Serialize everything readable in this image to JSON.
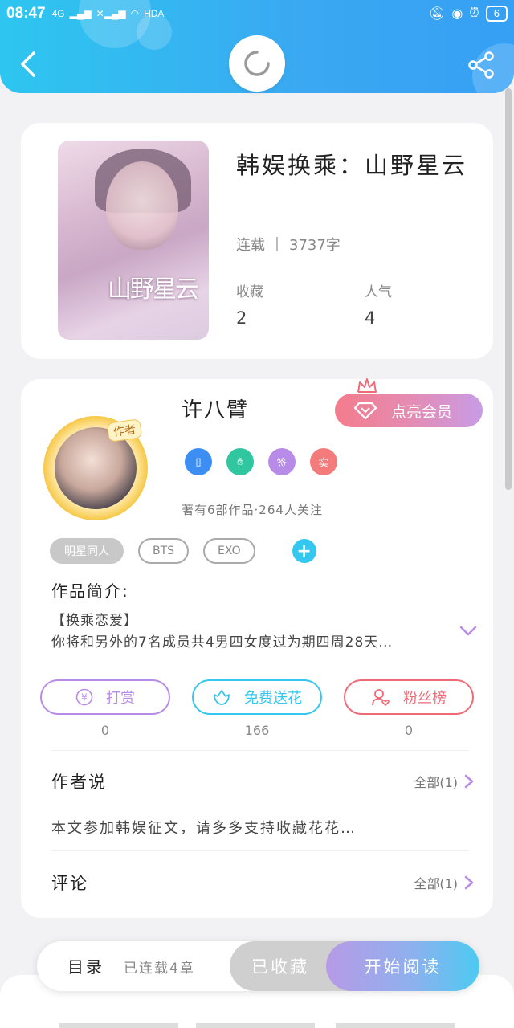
{
  "status_bar": {
    "time": "08:47",
    "network1": "4G",
    "network2": "HDA",
    "battery": "6"
  },
  "header": {
    "back_icon": "back-arrow-icon",
    "loading_icon": "loading-spinner-icon",
    "share_icon": "share-icon",
    "accent": "#2ec6f0"
  },
  "book": {
    "cover_title": "山野星云",
    "title": "韩娱换乘：山野星云",
    "status": "连载",
    "word_count": "3737字",
    "favorites_label": "收藏",
    "favorites_value": "2",
    "popularity_label": "人气",
    "popularity_value": "4"
  },
  "author": {
    "tag": "作者",
    "name": "许八臂",
    "vip_button": "点亮会员",
    "badges": [
      {
        "text": "",
        "color": "#3d8ef2",
        "icon": "phone-badge-icon"
      },
      {
        "text": "",
        "color": "#2fc6a0",
        "icon": "handshake-badge-icon"
      },
      {
        "text": "签",
        "color": "#b98be8"
      },
      {
        "text": "实",
        "color": "#f47b7b"
      }
    ],
    "works_info": "著有6部作品·264人关注"
  },
  "tags": [
    "明星同人",
    "BTS",
    "EXO"
  ],
  "intro": {
    "label": "作品简介:",
    "line1": "【换乘恋爱】",
    "line2": "你将和另外的7名成员共4男四女度过为期四周28天…"
  },
  "actions": [
    {
      "label": "打赏",
      "count": "0",
      "color": "#b98be8",
      "icon": "yen-icon"
    },
    {
      "label": "免费送花",
      "count": "166",
      "color": "#35c7f0",
      "icon": "flower-icon"
    },
    {
      "label": "粉丝榜",
      "count": "0",
      "color": "#f06a76",
      "icon": "fan-user-icon"
    }
  ],
  "author_says": {
    "title": "作者说",
    "more": "全部(1)",
    "text": "本文参加韩娱征文，请多多支持收藏花花…"
  },
  "comments": {
    "title": "评论",
    "more": "全部(1)"
  },
  "bottom": {
    "toc_label": "目录",
    "toc_status": "已连载4章",
    "fav_button": "已收藏",
    "read_button": "开始阅读"
  }
}
